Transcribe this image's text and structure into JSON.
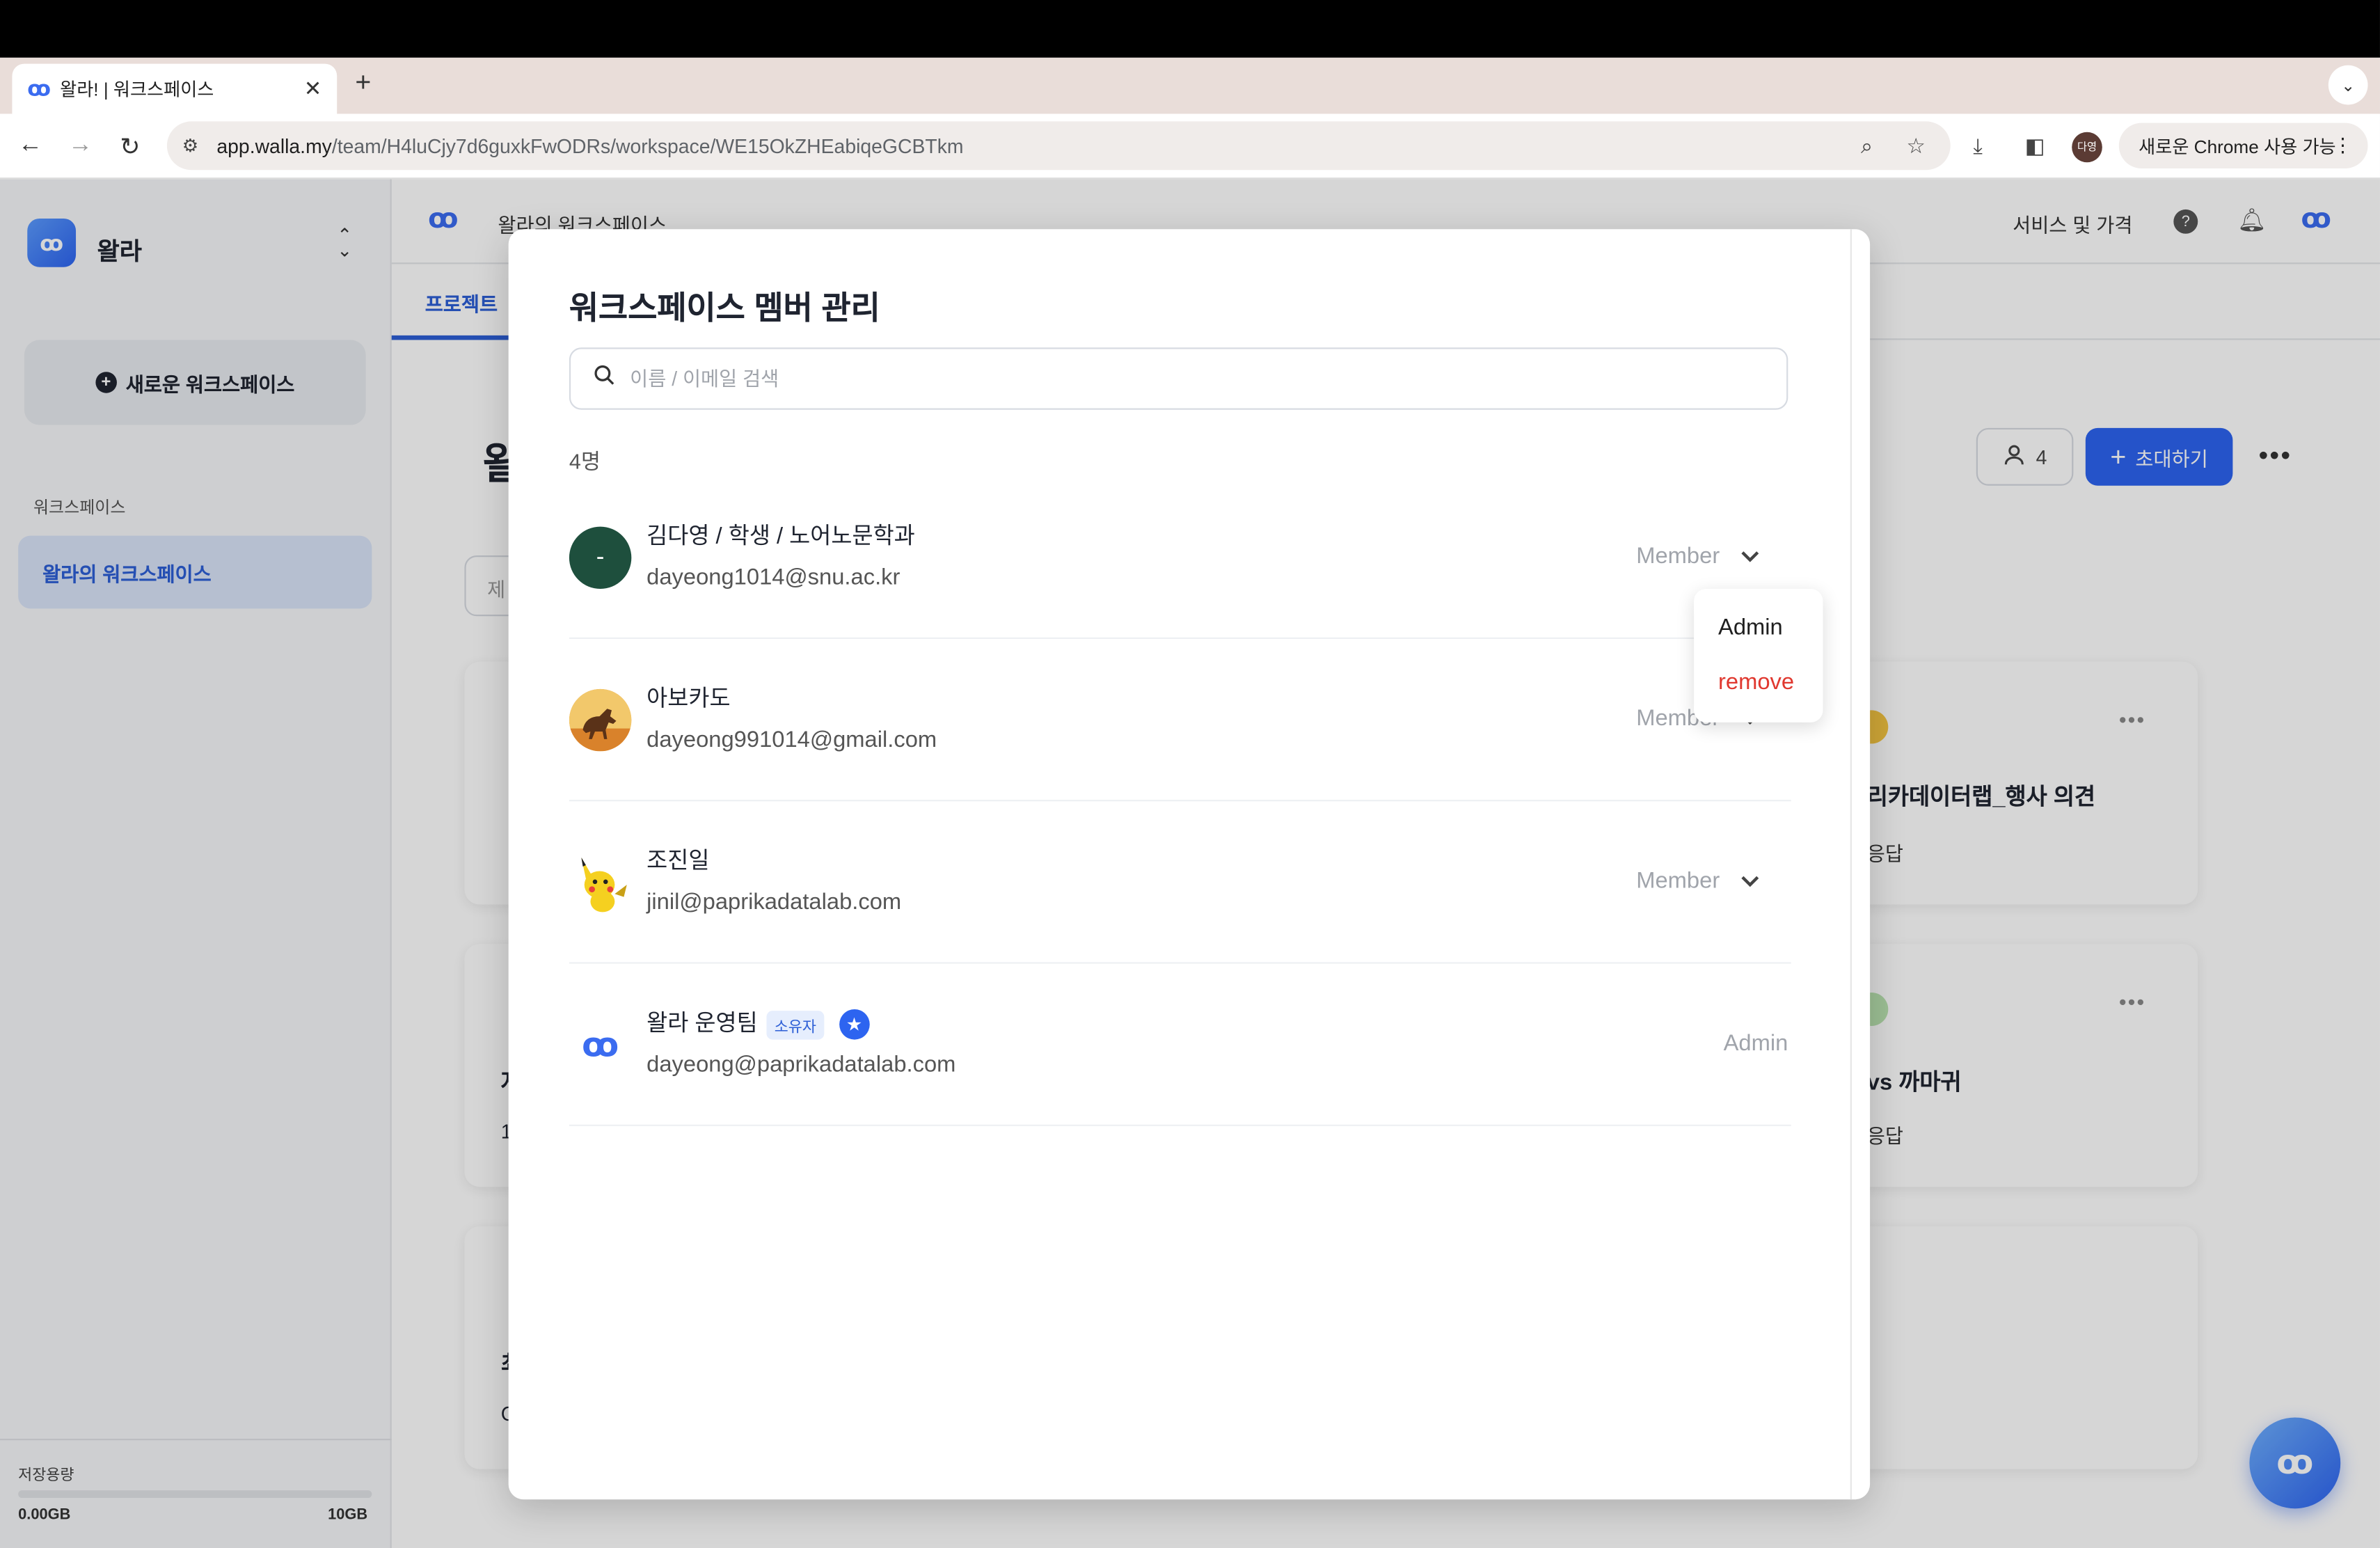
{
  "browser": {
    "tab_title": "왈라! | 워크스페이스",
    "new_tab": "+",
    "url_host": "app.walla.my",
    "url_path": "/team/H4luCjy7d6guxkFwODRs/workspace/WE15OkZHEabiqeGCBTkm",
    "profile_initials": "다영",
    "promo_label": "새로운 Chrome 사용 가능"
  },
  "sidebar": {
    "brand": "왈라",
    "new_workspace": "새로운 워크스페이스",
    "section_label": "워크스페이스",
    "workspace_item": "왈라의 워크스페이스",
    "storage_label": "저장용량",
    "storage_used": "0.00GB",
    "storage_total": "10GB",
    "storage_fraction": 0
  },
  "header": {
    "workspace_title": "왈라의 워크스페이스",
    "pricing": "서비스 및 가격",
    "tab_project": "프로젝트"
  },
  "main": {
    "heading_char": "왈",
    "member_count": "4",
    "invite": "초대하기",
    "filter_placeholder": "제",
    "cards": [
      {
        "title": "리카데이터랩_행사 의견",
        "sub": "응답"
      },
      {
        "title": "vs 까마귀",
        "sub": "응답"
      }
    ],
    "card_left_chars": [
      "자",
      "1",
      "최",
      "C"
    ]
  },
  "modal": {
    "title": "워크스페이스 멤버 관리",
    "search_placeholder": "이름 / 이메일 검색",
    "count_label": "4명",
    "members": [
      {
        "name": "김다영 / 학생 / 노어노문학과",
        "email": "dayeong1014@snu.ac.kr",
        "role": "Member",
        "avatar_text": "-"
      },
      {
        "name": "아보카도",
        "email": "dayeong991014@gmail.com",
        "role": "Member"
      },
      {
        "name": "조진일",
        "email": "jinil@paprikadatalab.com",
        "role": "Member"
      },
      {
        "name": "왈라 운영팀",
        "email": "dayeong@paprikadatalab.com",
        "role": "Admin",
        "badge": "소유자"
      }
    ],
    "role_menu": {
      "admin": "Admin",
      "remove": "remove"
    }
  },
  "colors": {
    "accent": "#2d64f0",
    "danger": "#e0382f",
    "avatar_dark": "#1e4f3d"
  }
}
